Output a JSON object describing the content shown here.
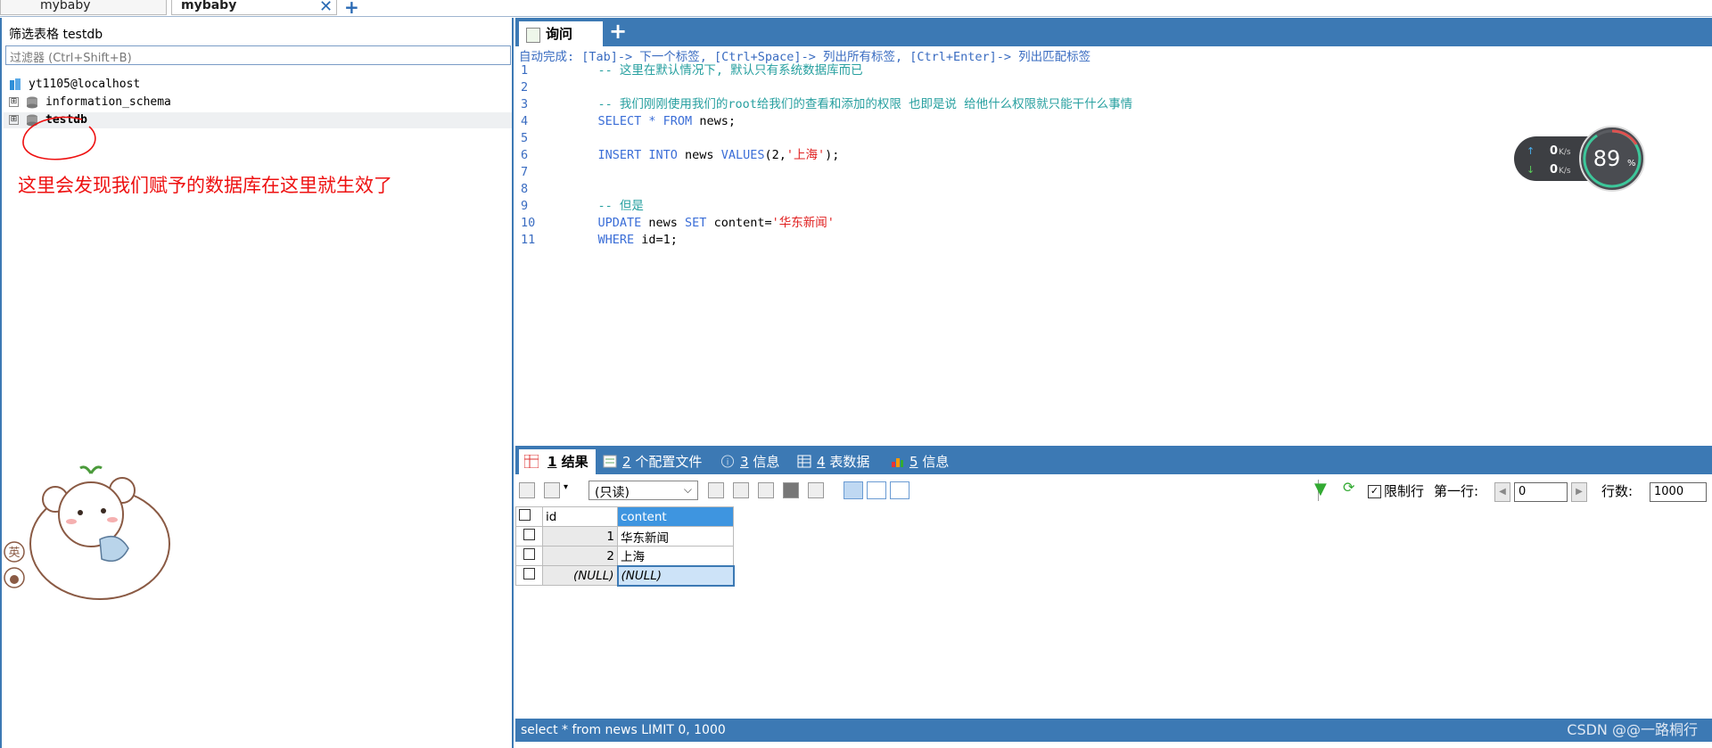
{
  "connection_tabs": [
    {
      "label": "mybaby"
    },
    {
      "label": "mybaby"
    }
  ],
  "connection_tab_close": "✕",
  "connection_tab_add": "+",
  "left_panel": {
    "title": "筛选表格 testdb",
    "filter_placeholder": "过滤器 (Ctrl+Shift+B)",
    "tree": {
      "connection": "yt1105@localhost",
      "databases": [
        {
          "name": "information_schema",
          "expander": "⊞"
        },
        {
          "name": "testdb",
          "expander": "⊞"
        }
      ]
    },
    "annotation": "这里会发现我们赋予的数据库在这里就生效了",
    "sticker_badges": [
      "英",
      "🐻"
    ]
  },
  "query_tabs": {
    "active_label": "询问",
    "add": "+"
  },
  "editor": {
    "hint": "自动完成: [Tab]-> 下一个标签, [Ctrl+Space]-> 列出所有标签, [Ctrl+Enter]-> 列出匹配标签",
    "lines": [
      {
        "n": "1",
        "parts": [
          {
            "t": "    -- 这里在默认情况下, 默认只有系统数据库而已",
            "c": "cm"
          }
        ]
      },
      {
        "n": "2",
        "parts": []
      },
      {
        "n": "3",
        "parts": [
          {
            "t": "    -- 我们刚刚使用我们的root给我们的查看和添加的权限 也即是说 给他什么权限就只能干什么事情",
            "c": "cm"
          }
        ]
      },
      {
        "n": "4",
        "parts": [
          {
            "t": "    SELECT * FROM ",
            "c": "kw"
          },
          {
            "t": "news;",
            "c": ""
          }
        ]
      },
      {
        "n": "5",
        "parts": []
      },
      {
        "n": "6",
        "parts": [
          {
            "t": "    INSERT INTO ",
            "c": "kw"
          },
          {
            "t": "news ",
            "c": ""
          },
          {
            "t": "VALUES",
            "c": "kw"
          },
          {
            "t": "(2,",
            "c": ""
          },
          {
            "t": "'上海'",
            "c": "str"
          },
          {
            "t": ");",
            "c": ""
          }
        ]
      },
      {
        "n": "7",
        "parts": []
      },
      {
        "n": "8",
        "parts": []
      },
      {
        "n": "9",
        "parts": [
          {
            "t": "    -- 但是",
            "c": "cm"
          }
        ]
      },
      {
        "n": "10",
        "parts": [
          {
            "t": "    UPDATE ",
            "c": "kw"
          },
          {
            "t": "news ",
            "c": ""
          },
          {
            "t": "SET ",
            "c": "kw"
          },
          {
            "t": "content=",
            "c": ""
          },
          {
            "t": "'华东新闻'",
            "c": "str"
          }
        ]
      },
      {
        "n": "11",
        "parts": [
          {
            "t": "    WHERE ",
            "c": "kw"
          },
          {
            "t": "id=1;",
            "c": ""
          }
        ]
      }
    ]
  },
  "net_widget": {
    "up": "0",
    "down": "0",
    "unit": "K/s",
    "percent": "89",
    "percent_sign": "%"
  },
  "result_tabs": [
    {
      "num": "1",
      "label": " 结果"
    },
    {
      "num": "2",
      "label": " 个配置文件"
    },
    {
      "num": "3",
      "label": " 信息"
    },
    {
      "num": "4",
      "label": " 表数据"
    },
    {
      "num": "5",
      "label": " 信息"
    }
  ],
  "result_toolbar": {
    "readonly_select": "(只读)",
    "limit_rows_label": "限制行",
    "first_row_label": "第一行:",
    "first_row_value": "0",
    "rows_label": "行数:",
    "rows_value": "1000"
  },
  "grid": {
    "columns": [
      "id",
      "content"
    ],
    "rows": [
      {
        "id": "1",
        "content": "华东新闻"
      },
      {
        "id": "2",
        "content": "上海"
      },
      {
        "id": "(NULL)",
        "content": "(NULL)"
      }
    ]
  },
  "status_bar": {
    "text": "select * from news LIMIT 0, 1000",
    "watermark": "CSDN @@一路桐行"
  },
  "colors": {
    "accent": "#3c79b4",
    "comment": "#28a0a0",
    "keyword": "#3b6ed7",
    "string": "#e02020",
    "annotation": "#e11111"
  }
}
